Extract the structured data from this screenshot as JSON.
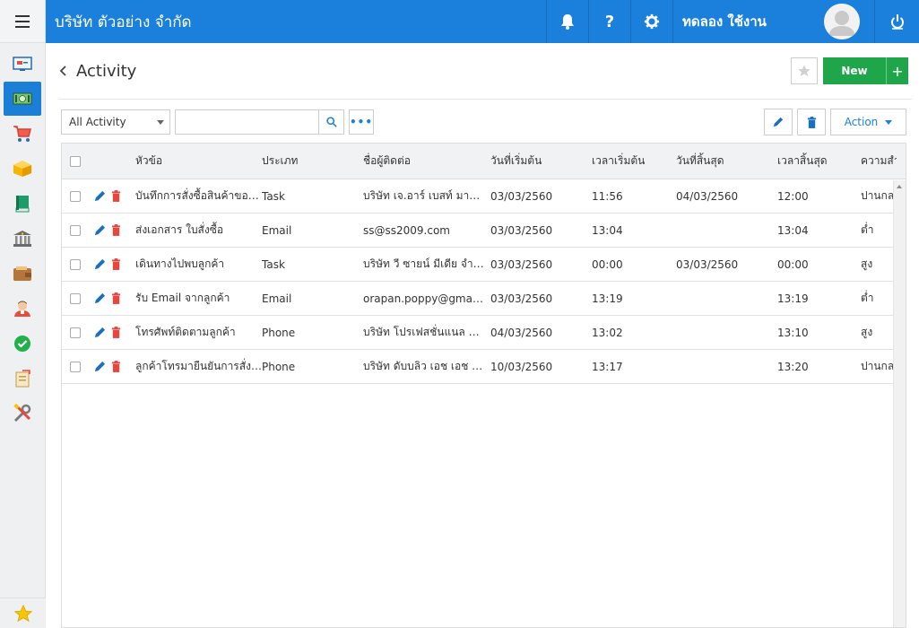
{
  "header": {
    "company": "บริษัท ตัวอย่าง จำกัด",
    "user_name": "ทดลอง ใช้งาน",
    "help_label": "?"
  },
  "sidebar": {
    "items": [
      {
        "name": "dashboard-icon"
      },
      {
        "name": "money-icon",
        "active": true
      },
      {
        "name": "cart-icon"
      },
      {
        "name": "box-icon"
      },
      {
        "name": "book-icon"
      },
      {
        "name": "bank-icon"
      },
      {
        "name": "wallet-icon"
      },
      {
        "name": "contact-icon"
      },
      {
        "name": "check-icon"
      },
      {
        "name": "report-icon"
      },
      {
        "name": "tools-icon"
      }
    ]
  },
  "page": {
    "title": "Activity",
    "new_label": "New",
    "plus_label": "+"
  },
  "filter": {
    "selected": "All Activity",
    "search_value": "",
    "search_placeholder": "",
    "more_label": "•••",
    "action_label": "Action"
  },
  "table": {
    "columns": [
      "หัวข้อ",
      "ประเภท",
      "ชื่อผู้ติดต่อ",
      "วันที่เริ่มต้น",
      "เวลาเริ่มต้น",
      "วันที่สิ้นสุด",
      "เวลาสิ้นสุด",
      "ความสำ"
    ],
    "rows": [
      {
        "subject": "บันทึกการสั่งซื้อสินค้าของลูกค้า",
        "type": "Task",
        "contact": "บริษัท เจ.อาร์ เบสท์ มาร์เก็ตติ้ง",
        "start_date": "03/03/2560",
        "start_time": "11:56",
        "end_date": "04/03/2560",
        "end_time": "12:00",
        "priority": "ปานกลาง"
      },
      {
        "subject": "ส่งเอกสาร ใบสั่งซื้อ",
        "type": "Email",
        "contact": "ss@ss2009.com",
        "start_date": "03/03/2560",
        "start_time": "13:04",
        "end_date": "",
        "end_time": "13:04",
        "priority": "ต่ำ"
      },
      {
        "subject": "เดินทางไปพบลูกค้า",
        "type": "Task",
        "contact": "บริษัท วี ซายน์ มีเดีย จำกัด",
        "start_date": "03/03/2560",
        "start_time": "00:00",
        "end_date": "03/03/2560",
        "end_time": "00:00",
        "priority": "สูง"
      },
      {
        "subject": "รับ Email จากลูกค้า",
        "type": "Email",
        "contact": "orapan.poppy@gmail.com",
        "start_date": "03/03/2560",
        "start_time": "13:19",
        "end_date": "",
        "end_time": "13:19",
        "priority": "ต่ำ"
      },
      {
        "subject": "โทรศัพท์ติดตามลูกค้า",
        "type": "Phone",
        "contact": "บริษัท โปรเฟสชั่นแนล จำกัด",
        "start_date": "04/03/2560",
        "start_time": "13:02",
        "end_date": "",
        "end_time": "13:10",
        "priority": "สูง"
      },
      {
        "subject": "ลูกค้าโทรมายืนยันการสั่งซื้อ",
        "type": "Phone",
        "contact": "บริษัท ดับบลิว เอช เอช จำกัด",
        "start_date": "10/03/2560",
        "start_time": "13:17",
        "end_date": "",
        "end_time": "13:20",
        "priority": "ปานกลาง"
      }
    ]
  },
  "colors": {
    "topbar": "#1a80dc",
    "accent_green": "#20a64a",
    "delete_red": "#e8453c",
    "edit_blue": "#1a6fbf"
  }
}
